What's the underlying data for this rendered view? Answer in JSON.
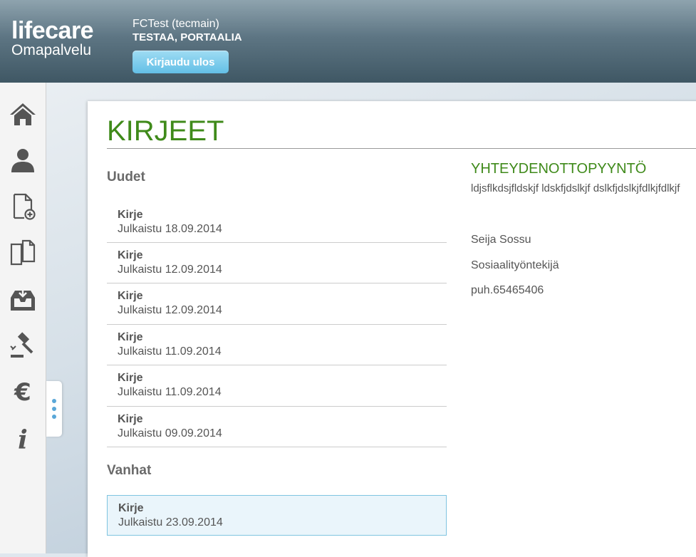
{
  "brand": {
    "name": "lifecare",
    "subtitle": "Omapalvelu"
  },
  "user": {
    "name": "FCTest (tecmain)",
    "org": "TESTAA, PORTAALIA",
    "logout_label": "Kirjaudu ulos"
  },
  "sidebar": {
    "items": [
      {
        "icon": "home-icon"
      },
      {
        "icon": "person-icon"
      },
      {
        "icon": "new-document-icon"
      },
      {
        "icon": "documents-icon"
      },
      {
        "icon": "inbox-icon"
      },
      {
        "icon": "gavel-icon"
      },
      {
        "icon": "euro-icon"
      },
      {
        "icon": "info-icon"
      }
    ]
  },
  "page": {
    "title": "KIRJEET"
  },
  "new_section": {
    "heading": "Uudet",
    "items": [
      {
        "title": "Kirje",
        "date": "Julkaistu 18.09.2014"
      },
      {
        "title": "Kirje",
        "date": "Julkaistu 12.09.2014"
      },
      {
        "title": "Kirje",
        "date": "Julkaistu 12.09.2014"
      },
      {
        "title": "Kirje",
        "date": "Julkaistu 11.09.2014"
      },
      {
        "title": "Kirje",
        "date": "Julkaistu 11.09.2014"
      },
      {
        "title": "Kirje",
        "date": "Julkaistu 09.09.2014"
      }
    ]
  },
  "old_section": {
    "heading": "Vanhat",
    "items": [
      {
        "title": "Kirje",
        "date": "Julkaistu 23.09.2014"
      }
    ]
  },
  "detail": {
    "title": "YHTEYDENOTTOPYYNTÖ",
    "body": "ldjsflkdsjfldskjf ldskfjdslkjf dslkfjdslkjfdlkjfdlkjf",
    "sender_name": "Seija Sossu",
    "sender_role": "Sosiaalityöntekijä",
    "sender_phone": "puh.65465406"
  },
  "colors": {
    "accent_green": "#3f8a1a",
    "button_blue": "#63bfe6",
    "header_dark": "#3f5764"
  }
}
